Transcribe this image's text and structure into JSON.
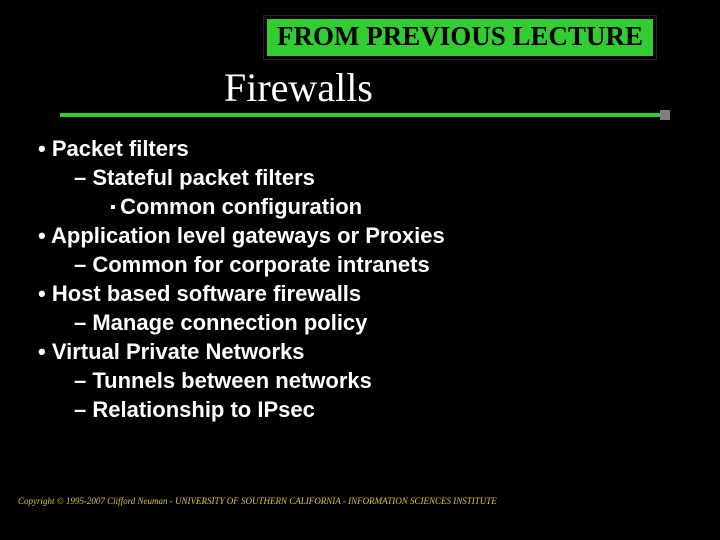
{
  "banner": "FROM PREVIOUS LECTURE",
  "title": "Firewalls",
  "bullets": {
    "l0": "Packet filters",
    "l0a": "Stateful packet filters",
    "l0a1": "Common configuration",
    "l1": "Application level gateways or Proxies",
    "l1a": "Common for  corporate intranets",
    "l2": "Host based software firewalls",
    "l2a": "Manage connection policy",
    "l3": "Virtual Private Networks",
    "l3a": "Tunnels between networks",
    "l3b": "Relationship to IPsec"
  },
  "footer": "Copyright © 1995-2007 Clifford Neuman - UNIVERSITY OF SOUTHERN CALIFORNIA - INFORMATION SCIENCES INSTITUTE"
}
